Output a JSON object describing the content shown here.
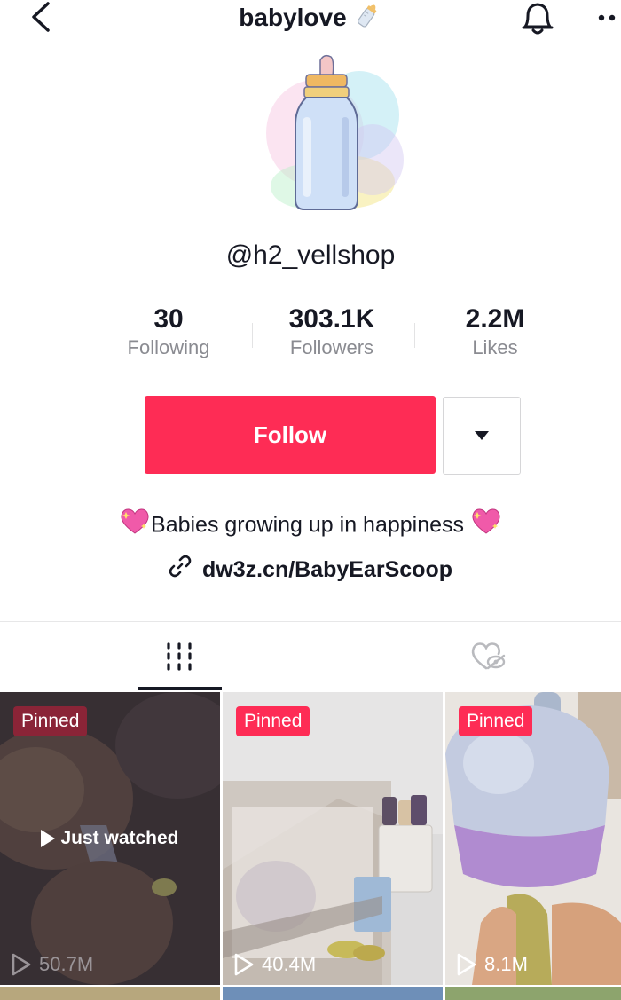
{
  "header": {
    "title": "babylove",
    "title_emoji_icon": "baby-bottle-icon",
    "notification_icon": "bell-icon",
    "more_icon": "more-dots-icon",
    "back_icon": "chevron-left-icon"
  },
  "profile": {
    "username": "@h2_vellshop",
    "stats": [
      {
        "value": "30",
        "label": "Following"
      },
      {
        "value": "303.1K",
        "label": "Followers"
      },
      {
        "value": "2.2M",
        "label": "Likes"
      }
    ],
    "follow_label": "Follow",
    "bio": "Babies growing up in happiness",
    "bio_icon": "sparkling-heart-icon",
    "link": "dw3z.cn/BabyEarScoop",
    "link_icon": "link-icon"
  },
  "tabs": [
    {
      "icon": "videos-grid-icon",
      "active": true
    },
    {
      "icon": "liked-hidden-icon",
      "active": false
    }
  ],
  "videos": [
    {
      "badge": "Pinned",
      "views": "50.7M",
      "overlay": "Just watched"
    },
    {
      "badge": "Pinned",
      "views": "40.4M"
    },
    {
      "badge": "Pinned",
      "views": "8.1M"
    }
  ],
  "colors": {
    "accent": "#fe2c55",
    "text": "#161823",
    "secondary_text": "#8a8b91"
  }
}
